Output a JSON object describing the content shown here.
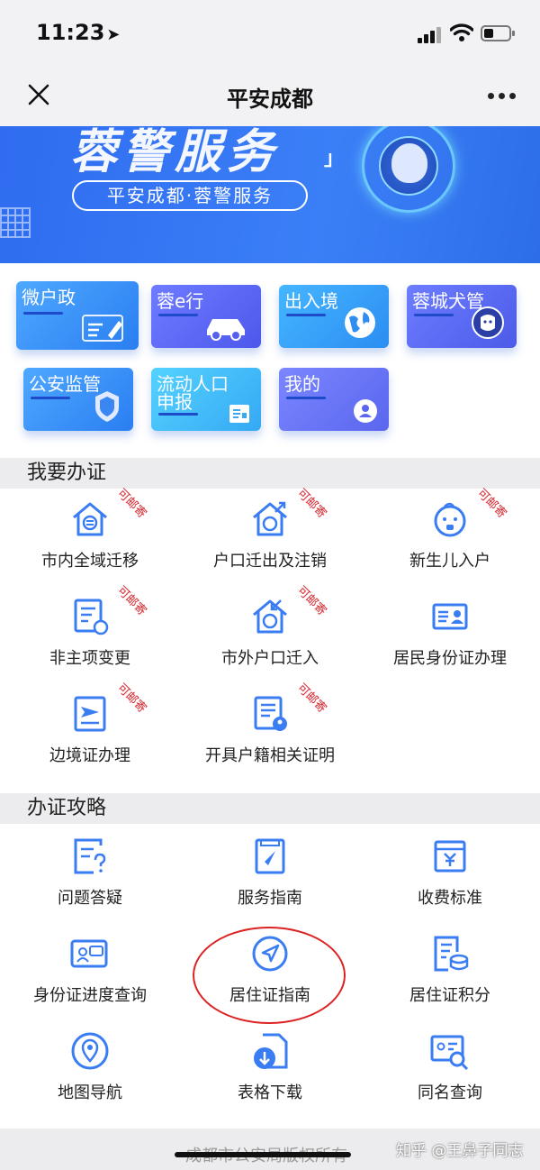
{
  "status_bar": {
    "time": "11:23",
    "arrow": "➤"
  },
  "navbar": {
    "title": "平安成都"
  },
  "banner": {
    "headline": "蓉警服务",
    "bracket": "」",
    "pill_text": "平安成都·蓉警服务"
  },
  "tiles": [
    {
      "label": "微户政",
      "icon": "edit-card-icon"
    },
    {
      "label": "蓉e行",
      "icon": "car-icon"
    },
    {
      "label": "出入境",
      "icon": "globe-icon"
    },
    {
      "label": "蓉城犬管",
      "icon": "dog-icon"
    },
    {
      "label": "公安监管",
      "icon": "police-badge-icon"
    },
    {
      "label": "流动人口\n申报",
      "icon": "id-card-icon"
    },
    {
      "label": "我的",
      "icon": "user-icon"
    }
  ],
  "section_apply": {
    "title": "我要办证"
  },
  "apply_items": [
    {
      "label": "市内全域迁移",
      "stamp": "可邮寄"
    },
    {
      "label": "户口迁出及注销",
      "stamp": "可邮寄"
    },
    {
      "label": "新生儿入户",
      "stamp": "可邮寄"
    },
    {
      "label": "非主项变更",
      "stamp": "可邮寄"
    },
    {
      "label": "市外户口迁入",
      "stamp": "可邮寄"
    },
    {
      "label": "居民身份证办理",
      "stamp": ""
    },
    {
      "label": "边境证办理",
      "stamp": "可邮寄"
    },
    {
      "label": "开具户籍相关证明",
      "stamp": "可邮寄"
    }
  ],
  "section_guide": {
    "title": "办证攻略"
  },
  "guide_items": [
    {
      "label": "问题答疑"
    },
    {
      "label": "服务指南"
    },
    {
      "label": "收费标准"
    },
    {
      "label": "身份证进度查询"
    },
    {
      "label": "居住证指南"
    },
    {
      "label": "居住证积分"
    },
    {
      "label": "地图导航"
    },
    {
      "label": "表格下载"
    },
    {
      "label": "同名查询"
    }
  ],
  "footer": {
    "copyright": "成都市公安局版权所有",
    "watermark": "知乎 @王鼻子同志"
  },
  "colors": {
    "accent": "#3a7cf2",
    "stamp": "#d8232a",
    "banner": "#3b7ff7"
  }
}
